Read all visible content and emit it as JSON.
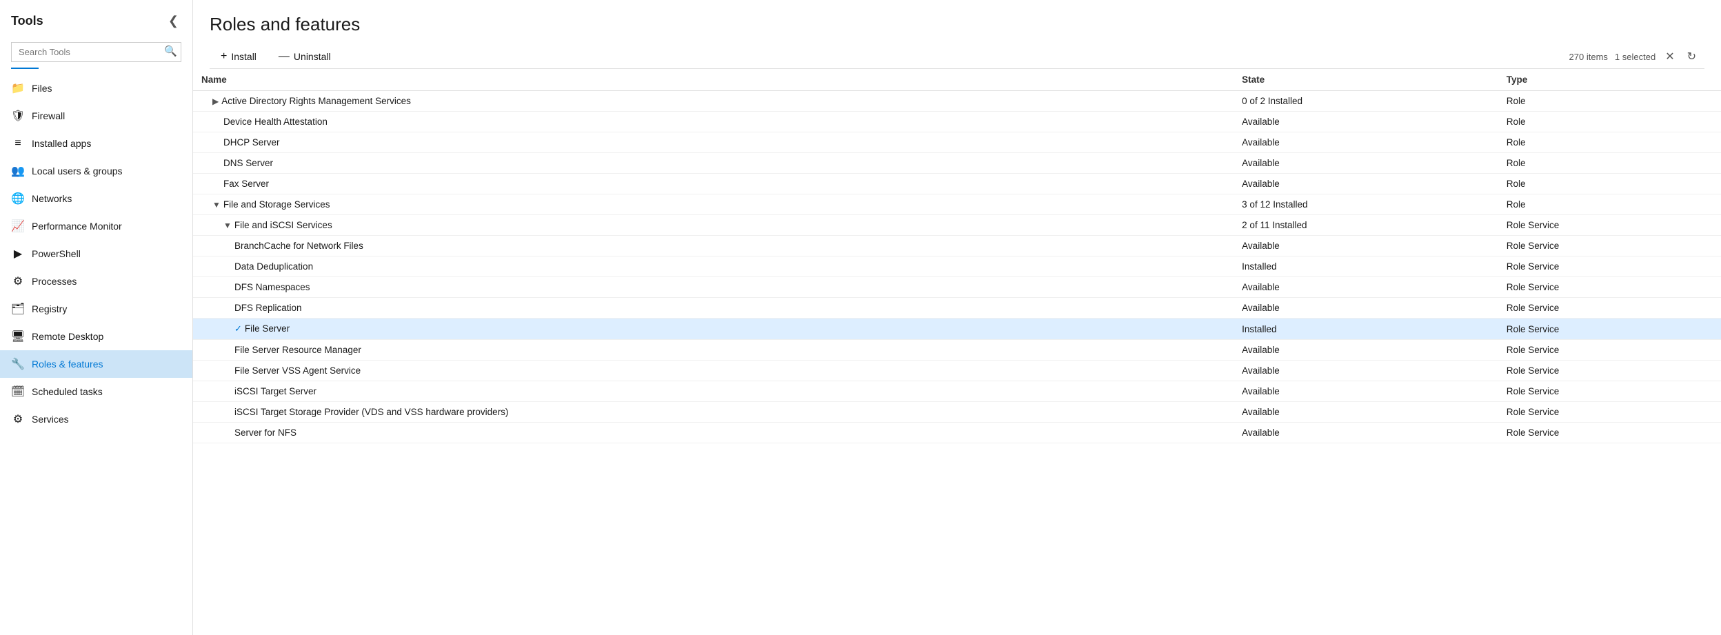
{
  "sidebar": {
    "title": "Tools",
    "search_placeholder": "Search Tools",
    "underline_color": "#0078d4",
    "items": [
      {
        "id": "files",
        "label": "Files",
        "icon": "📁",
        "icon_color": "#f0a500",
        "active": false
      },
      {
        "id": "firewall",
        "label": "Firewall",
        "icon": "🔥",
        "icon_color": "#e74c3c",
        "active": false
      },
      {
        "id": "installed-apps",
        "label": "Installed apps",
        "icon": "≡",
        "icon_color": "#555",
        "active": false
      },
      {
        "id": "local-users-groups",
        "label": "Local users & groups",
        "icon": "👥",
        "icon_color": "#0078d4",
        "active": false
      },
      {
        "id": "networks",
        "label": "Networks",
        "icon": "🌐",
        "icon_color": "#0078d4",
        "active": false
      },
      {
        "id": "performance-monitor",
        "label": "Performance Monitor",
        "icon": "📊",
        "icon_color": "#7b68ee",
        "active": false
      },
      {
        "id": "powershell",
        "label": "PowerShell",
        "icon": "▶",
        "icon_color": "#1565c0",
        "active": false
      },
      {
        "id": "processes",
        "label": "Processes",
        "icon": "⚙",
        "icon_color": "#7b68ee",
        "active": false
      },
      {
        "id": "registry",
        "label": "Registry",
        "icon": "🗂",
        "icon_color": "#7b68ee",
        "active": false
      },
      {
        "id": "remote-desktop",
        "label": "Remote Desktop",
        "icon": "🖥",
        "icon_color": "#0078d4",
        "active": false
      },
      {
        "id": "roles-features",
        "label": "Roles & features",
        "icon": "🔧",
        "icon_color": "#0078d4",
        "active": true
      },
      {
        "id": "scheduled-tasks",
        "label": "Scheduled tasks",
        "icon": "⚙",
        "icon_color": "#4caf50",
        "active": false
      },
      {
        "id": "services",
        "label": "Services",
        "icon": "⚙",
        "icon_color": "#4caf50",
        "active": false
      }
    ]
  },
  "main": {
    "page_title": "Roles and features",
    "toolbar": {
      "install_label": "Install",
      "uninstall_label": "Uninstall",
      "items_count": "270 items",
      "selected_count": "1 selected"
    },
    "table": {
      "columns": [
        "Name",
        "State",
        "Type"
      ],
      "rows": [
        {
          "indent": 1,
          "expand": "▶",
          "name": "Active Directory Rights Management Services",
          "state": "0 of 2 Installed",
          "type": "Role",
          "selected": false,
          "checked": false
        },
        {
          "indent": 2,
          "expand": "",
          "name": "Device Health Attestation",
          "state": "Available",
          "type": "Role",
          "selected": false,
          "checked": false
        },
        {
          "indent": 2,
          "expand": "",
          "name": "DHCP Server",
          "state": "Available",
          "type": "Role",
          "selected": false,
          "checked": false
        },
        {
          "indent": 2,
          "expand": "",
          "name": "DNS Server",
          "state": "Available",
          "type": "Role",
          "selected": false,
          "checked": false
        },
        {
          "indent": 2,
          "expand": "",
          "name": "Fax Server",
          "state": "Available",
          "type": "Role",
          "selected": false,
          "checked": false
        },
        {
          "indent": 1,
          "expand": "▼",
          "name": "File and Storage Services",
          "state": "3 of 12 Installed",
          "type": "Role",
          "selected": false,
          "checked": false
        },
        {
          "indent": 2,
          "expand": "▼",
          "name": "File and iSCSI Services",
          "state": "2 of 11 Installed",
          "type": "Role Service",
          "selected": false,
          "checked": false
        },
        {
          "indent": 3,
          "expand": "",
          "name": "BranchCache for Network Files",
          "state": "Available",
          "type": "Role Service",
          "selected": false,
          "checked": false
        },
        {
          "indent": 3,
          "expand": "",
          "name": "Data Deduplication",
          "state": "Installed",
          "type": "Role Service",
          "selected": false,
          "checked": false
        },
        {
          "indent": 3,
          "expand": "",
          "name": "DFS Namespaces",
          "state": "Available",
          "type": "Role Service",
          "selected": false,
          "checked": false
        },
        {
          "indent": 3,
          "expand": "",
          "name": "DFS Replication",
          "state": "Available",
          "type": "Role Service",
          "selected": false,
          "checked": false
        },
        {
          "indent": 3,
          "expand": "",
          "name": "File Server",
          "state": "Installed",
          "type": "Role Service",
          "selected": true,
          "checked": true
        },
        {
          "indent": 3,
          "expand": "",
          "name": "File Server Resource Manager",
          "state": "Available",
          "type": "Role Service",
          "selected": false,
          "checked": false
        },
        {
          "indent": 3,
          "expand": "",
          "name": "File Server VSS Agent Service",
          "state": "Available",
          "type": "Role Service",
          "selected": false,
          "checked": false
        },
        {
          "indent": 3,
          "expand": "",
          "name": "iSCSI Target Server",
          "state": "Available",
          "type": "Role Service",
          "selected": false,
          "checked": false
        },
        {
          "indent": 3,
          "expand": "",
          "name": "iSCSI Target Storage Provider (VDS and VSS hardware providers)",
          "state": "Available",
          "type": "Role Service",
          "selected": false,
          "checked": false
        },
        {
          "indent": 3,
          "expand": "",
          "name": "Server for NFS",
          "state": "Available",
          "type": "Role Service",
          "selected": false,
          "checked": false
        }
      ]
    }
  }
}
